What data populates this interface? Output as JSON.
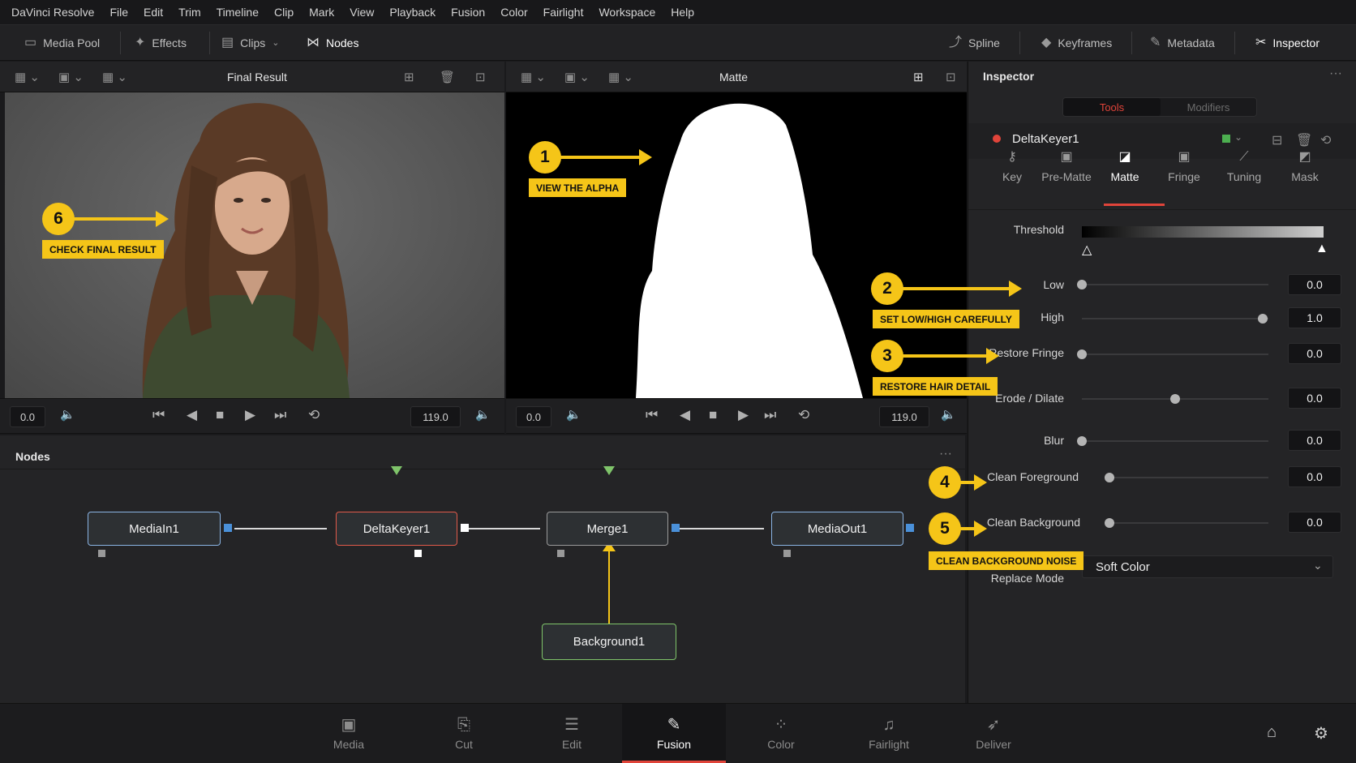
{
  "menu": [
    "DaVinci Resolve",
    "File",
    "Edit",
    "Trim",
    "Timeline",
    "Clip",
    "Mark",
    "View",
    "Playback",
    "Fusion",
    "Color",
    "Fairlight",
    "Workspace",
    "Help"
  ],
  "toolbar": {
    "media_pool": "Media Pool",
    "effects": "Effects",
    "clips": "Clips",
    "nodes": "Nodes",
    "spline": "Spline",
    "keyframes": "Keyframes",
    "metadata": "Metadata",
    "inspector": "Inspector"
  },
  "viewer_left": {
    "title": "Final Result",
    "time_start": "0.0",
    "time_end": "119.0"
  },
  "viewer_right": {
    "title": "Matte",
    "time_start": "0.0",
    "time_end": "119.0"
  },
  "nodes_panel": {
    "title": "Nodes",
    "nodes": [
      "MediaIn1",
      "DeltaKeyer1",
      "Merge1",
      "MediaOut1",
      "Background1"
    ]
  },
  "inspector": {
    "title": "Inspector",
    "tabs": [
      "Tools",
      "Modifiers"
    ],
    "tool_name": "DeltaKeyer1",
    "subtabs": [
      "Key",
      "Pre-Matte",
      "Matte",
      "Fringe",
      "Tuning",
      "Mask"
    ],
    "active_subtab": "Matte",
    "threshold_label": "Threshold",
    "params": [
      {
        "label": "Low",
        "value": "0.0",
        "level": 0.0
      },
      {
        "label": "High",
        "value": "1.0",
        "level": 1.0
      },
      {
        "label": "Restore Fringe",
        "value": "0.0",
        "level": 0.0
      },
      {
        "label": "Erode / Dilate",
        "value": "0.0",
        "level": 0.5
      },
      {
        "label": "Blur",
        "value": "0.0",
        "level": 0.0
      },
      {
        "label": "Clean Foreground",
        "value": "0.0",
        "level": 0.0
      },
      {
        "label": "Clean Background",
        "value": "0.0",
        "level": 0.0
      }
    ],
    "replace_mode_label": "Replace Mode",
    "replace_mode_value": "Soft Color"
  },
  "callouts": [
    {
      "num": "1",
      "text": "VIEW THE ALPHA"
    },
    {
      "num": "2",
      "text": "SET LOW/HIGH CAREFULLY"
    },
    {
      "num": "3",
      "text": "RESTORE HAIR DETAIL"
    },
    {
      "num": "4",
      "text": ""
    },
    {
      "num": "5",
      "text": "CLEAN BACKGROUND NOISE"
    },
    {
      "num": "6",
      "text": "CHECK FINAL RESULT"
    }
  ],
  "pages": [
    "Media",
    "Cut",
    "Edit",
    "Fusion",
    "Color",
    "Fairlight",
    "Deliver"
  ],
  "active_page": "Fusion",
  "colors": {
    "accent": "#f5c518",
    "active_tab_red": "#e0443a",
    "node_blue": "#8ab4e4",
    "node_red": "#e05a4a",
    "node_green": "#7fc46a"
  }
}
